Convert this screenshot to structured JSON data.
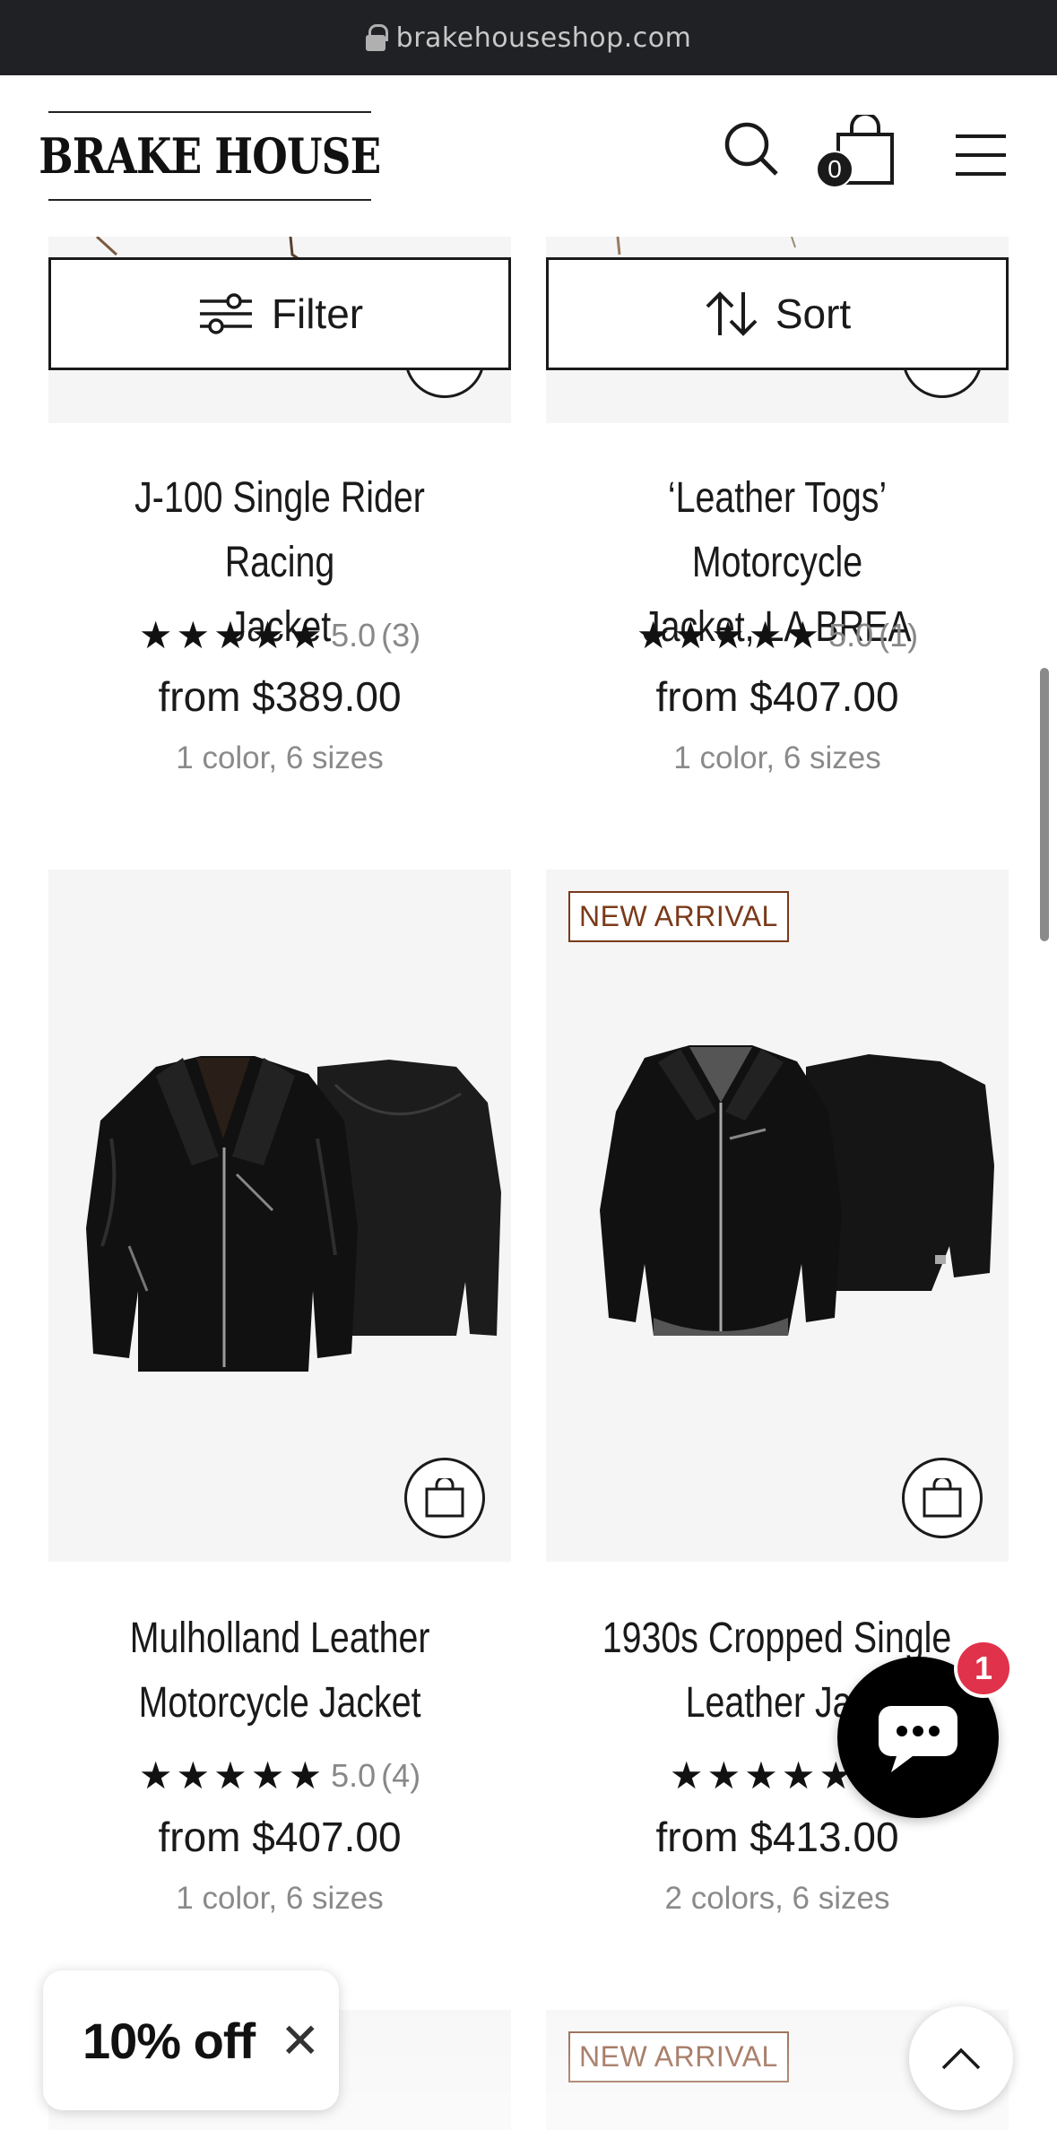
{
  "browser": {
    "url": "brakehouseshop.com"
  },
  "header": {
    "logo": "BRAKE HOUSE",
    "cart_count": "0"
  },
  "toolbar": {
    "filter_label": "Filter",
    "sort_label": "Sort"
  },
  "products": [
    {
      "title_line1": "J-100 Single Rider Racing",
      "title_line2": "Jacket",
      "stars": "★★★★★",
      "rating": "5.0",
      "reviews": "(3)",
      "price": "from $389.00",
      "variants": "1 color, 6 sizes"
    },
    {
      "title_line1": "‘Leather Togs’ Motorcycle",
      "title_line2": "Jacket, LA BREA",
      "stars": "★★★★★",
      "rating": "5.0",
      "reviews": "(1)",
      "price": "from $407.00",
      "variants": "1 color, 6 sizes"
    },
    {
      "title_line1": "Mulholland Leather",
      "title_line2": "Motorcycle Jacket",
      "stars": "★★★★★",
      "rating": "5.0",
      "reviews": "(4)",
      "price": "from $407.00",
      "variants": "1 color, 6 sizes"
    },
    {
      "title_line1": "1930s Cropped Single",
      "title_line2": "Leather Jac",
      "stars": "★★★★★",
      "rating": "5",
      "reviews": "",
      "price": "from $413.00",
      "variants": "2 colors, 6 sizes",
      "badge": "NEW ARRIVAL"
    },
    {
      "badge": "NEW ARRIVAL"
    }
  ],
  "chat": {
    "unread": "1"
  },
  "discount": {
    "label": "10% off",
    "close": "✕"
  },
  "colors": {
    "badge": "#7a3a1a",
    "chat_badge": "#e0324a",
    "image_bg": "#f5f5f5"
  },
  "icons": [
    "lock-icon",
    "search-icon",
    "bag-icon",
    "menu-icon",
    "filter-icon",
    "sort-icon",
    "quick-add-bag-icon",
    "chat-icon",
    "close-icon",
    "chevron-up-icon"
  ]
}
